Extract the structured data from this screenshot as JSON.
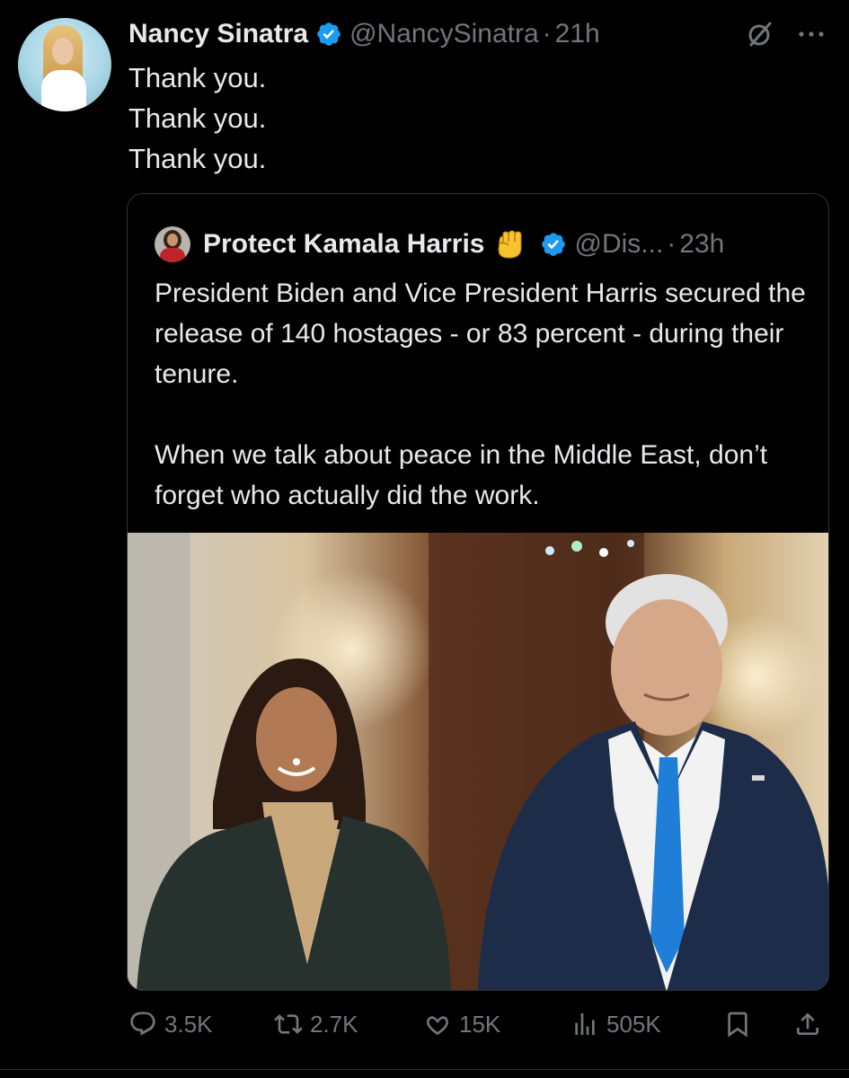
{
  "tweet": {
    "author_name": "Nancy Sinatra",
    "author_handle": "@NancySinatra",
    "separator": "·",
    "time": "21h",
    "text_lines": [
      "Thank you.",
      "Thank you.",
      "Thank you."
    ]
  },
  "quote": {
    "author_name": "Protect Kamala Harris",
    "author_handle": "@Dis...",
    "separator": "·",
    "time": "23h",
    "paragraphs": [
      "President Biden and Vice President Harris secured the release of 140 hostages - or 83 percent - during their tenure.",
      "When we talk about peace in the Middle East, don’t forget who actually did the work."
    ]
  },
  "actions": {
    "replies": "3.5K",
    "reposts": "2.7K",
    "likes": "15K",
    "views": "505K"
  },
  "icons": {
    "verified": "verified-badge-icon",
    "fist": "raised-fist-emoji-icon",
    "grok": "grok-icon",
    "more": "more-icon",
    "reply": "reply-icon",
    "repost": "repost-icon",
    "like": "like-icon",
    "views": "views-icon",
    "bookmark": "bookmark-icon",
    "share": "share-icon"
  },
  "colors": {
    "background": "#000000",
    "text": "#e7e9ea",
    "muted": "#71767b",
    "verified": "#1d9bf0",
    "border": "#2f3336"
  }
}
